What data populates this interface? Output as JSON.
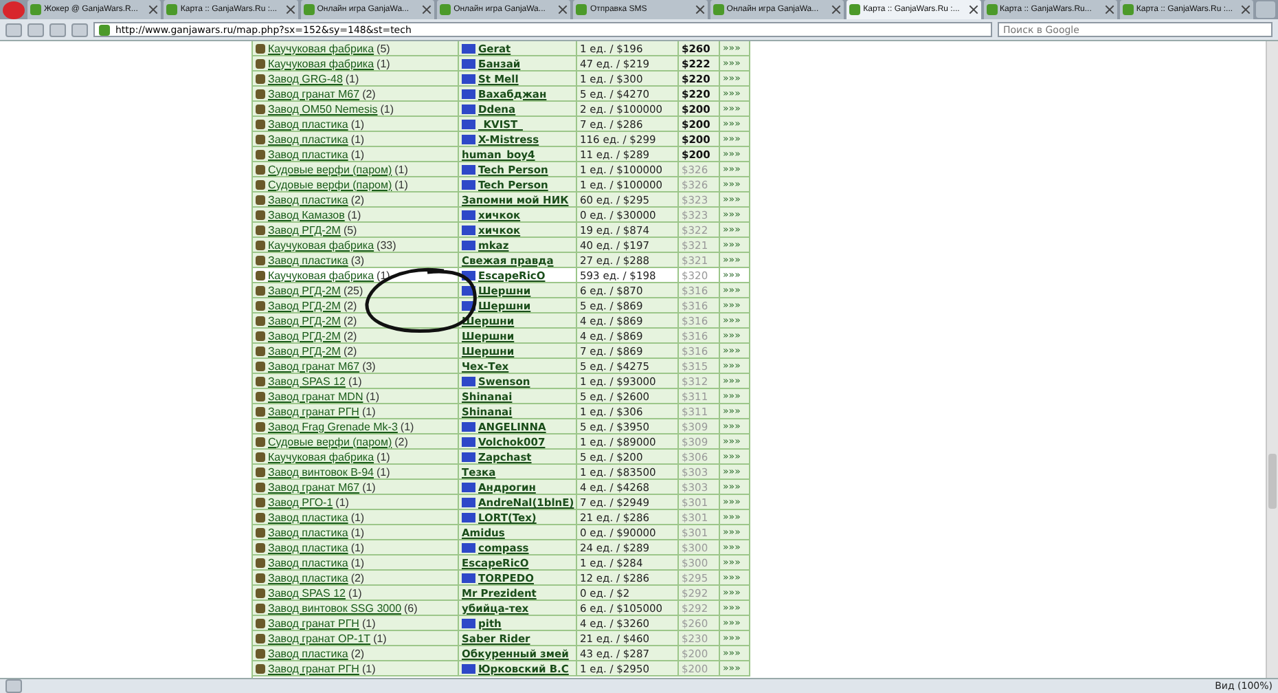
{
  "tabs": [
    {
      "label": "Жокер @ GanjaWars.R...",
      "selected": false
    },
    {
      "label": "Карта :: GanjaWars.Ru :...",
      "selected": false
    },
    {
      "label": "Онлайн игра GanjaWa...",
      "selected": false
    },
    {
      "label": "Онлайн игра GanjaWa...",
      "selected": false
    },
    {
      "label": "Отправка SMS",
      "selected": false
    },
    {
      "label": "Онлайн игра GanjaWa...",
      "selected": false
    },
    {
      "label": "Карта :: GanjaWars.Ru :...",
      "selected": true
    },
    {
      "label": "Карта :: GanjaWars.Ru...",
      "selected": false
    },
    {
      "label": "Карта :: GanjaWars.Ru :...",
      "selected": false
    }
  ],
  "address": "http://www.ganjawars.ru/map.php?sx=152&sy=148&st=tech",
  "search": {
    "placeholder": "Поиск в Google"
  },
  "rows": [
    {
      "factory": "Каучуковая фабрика",
      "count": "(5)",
      "owner": "Gerat",
      "logo": true,
      "stock": "1 ед. / $196",
      "price": "$260",
      "active": true,
      "highlighted": false,
      "more": "»»»"
    },
    {
      "factory": "Каучуковая фабрика",
      "count": "(1)",
      "owner": "Банзай",
      "logo": true,
      "stock": "47 ед. / $219",
      "price": "$222",
      "active": true,
      "highlighted": false,
      "more": "»»»"
    },
    {
      "factory": "Завод GRG-48",
      "count": "(1)",
      "owner": "St Mell",
      "logo": true,
      "stock": "1 ед. / $300",
      "price": "$220",
      "active": true,
      "highlighted": false,
      "more": "»»»"
    },
    {
      "factory": "Завод гранат М67",
      "count": "(2)",
      "owner": "Вахабджан",
      "logo": true,
      "stock": "5 ед. / $4270",
      "price": "$220",
      "active": true,
      "highlighted": false,
      "more": "»»»"
    },
    {
      "factory": "Завод OM50 Nemesis",
      "count": "(1)",
      "owner": "Ddena",
      "logo": true,
      "stock": "2 ед. / $100000",
      "price": "$200",
      "active": true,
      "highlighted": false,
      "more": "»»»"
    },
    {
      "factory": "Завод пластика",
      "count": "(1)",
      "owner": "_KVIST_",
      "logo": true,
      "stock": "7 ед. / $286",
      "price": "$200",
      "active": true,
      "highlighted": false,
      "more": "»»»"
    },
    {
      "factory": "Завод пластика",
      "count": "(1)",
      "owner": "X-Mistress",
      "logo": true,
      "stock": "116 ед. / $299",
      "price": "$200",
      "active": true,
      "highlighted": false,
      "more": "»»»"
    },
    {
      "factory": "Завод пластика",
      "count": "(1)",
      "owner": "human_boy4",
      "logo": false,
      "stock": "11 ед. / $289",
      "price": "$200",
      "active": true,
      "highlighted": false,
      "more": "»»»"
    },
    {
      "factory": "Судовые верфи (паром)",
      "count": "(1)",
      "owner": "Tech Person",
      "logo": true,
      "stock": "1 ед. / $100000",
      "price": "$326",
      "active": false,
      "highlighted": false,
      "more": "»»»"
    },
    {
      "factory": "Судовые верфи (паром)",
      "count": "(1)",
      "owner": "Tech Person",
      "logo": true,
      "stock": "1 ед. / $100000",
      "price": "$326",
      "active": false,
      "highlighted": false,
      "more": "»»»"
    },
    {
      "factory": "Завод пластика",
      "count": "(2)",
      "owner": "Запомни мой НИК",
      "logo": false,
      "stock": "60 ед. / $295",
      "price": "$323",
      "active": false,
      "highlighted": false,
      "more": "»»»"
    },
    {
      "factory": "Завод Камазов",
      "count": "(1)",
      "owner": "хичкок",
      "logo": true,
      "stock": "0 ед. / $30000",
      "price": "$323",
      "active": false,
      "highlighted": false,
      "more": "»»»"
    },
    {
      "factory": "Завод РГД-2М",
      "count": "(5)",
      "owner": "хичкок",
      "logo": true,
      "stock": "19 ед. / $874",
      "price": "$322",
      "active": false,
      "highlighted": false,
      "more": "»»»"
    },
    {
      "factory": "Каучуковая фабрика",
      "count": "(33)",
      "owner": "mkaz",
      "logo": true,
      "stock": "40 ед. / $197",
      "price": "$321",
      "active": false,
      "highlighted": false,
      "more": "»»»"
    },
    {
      "factory": "Завод пластика",
      "count": "(3)",
      "owner": "Свежая правда",
      "logo": false,
      "stock": "27 ед. / $288",
      "price": "$321",
      "active": false,
      "highlighted": false,
      "more": "»»»"
    },
    {
      "factory": "Каучуковая фабрика",
      "count": "(1)",
      "owner": "EscapeRicO",
      "logo": true,
      "stock": "593 ед. / $198",
      "price": "$320",
      "active": false,
      "highlighted": true,
      "more": "»»»"
    },
    {
      "factory": "Завод РГД-2М",
      "count": "(25)",
      "owner": "Шершни",
      "logo": true,
      "stock": "6 ед. / $870",
      "price": "$316",
      "active": false,
      "highlighted": false,
      "more": "»»»"
    },
    {
      "factory": "Завод РГД-2М",
      "count": "(2)",
      "owner": "Шершни",
      "logo": true,
      "stock": "5 ед. / $869",
      "price": "$316",
      "active": false,
      "highlighted": false,
      "more": "»»»"
    },
    {
      "factory": "Завод РГД-2М",
      "count": "(2)",
      "owner": "Шершни",
      "logo": false,
      "stock": "4 ед. / $869",
      "price": "$316",
      "active": false,
      "highlighted": false,
      "more": "»»»"
    },
    {
      "factory": "Завод РГД-2М",
      "count": "(2)",
      "owner": "Шершни",
      "logo": false,
      "stock": "4 ед. / $869",
      "price": "$316",
      "active": false,
      "highlighted": false,
      "more": "»»»"
    },
    {
      "factory": "Завод РГД-2М",
      "count": "(2)",
      "owner": "Шершни",
      "logo": false,
      "stock": "7 ед. / $869",
      "price": "$316",
      "active": false,
      "highlighted": false,
      "more": "»»»"
    },
    {
      "factory": "Завод гранат М67",
      "count": "(3)",
      "owner": "Чех-Тех",
      "logo": false,
      "stock": "5 ед. / $4275",
      "price": "$315",
      "active": false,
      "highlighted": false,
      "more": "»»»"
    },
    {
      "factory": "Завод SPAS 12",
      "count": "(1)",
      "owner": "Swenson",
      "logo": true,
      "stock": "1 ед. / $93000",
      "price": "$312",
      "active": false,
      "highlighted": false,
      "more": "»»»"
    },
    {
      "factory": "Завод гранат MDN",
      "count": "(1)",
      "owner": "Shinanai",
      "logo": false,
      "stock": "5 ед. / $2600",
      "price": "$311",
      "active": false,
      "highlighted": false,
      "more": "»»»"
    },
    {
      "factory": "Завод гранат РГН",
      "count": "(1)",
      "owner": "Shinanai",
      "logo": false,
      "stock": "1 ед. / $306",
      "price": "$311",
      "active": false,
      "highlighted": false,
      "more": "»»»"
    },
    {
      "factory": "Завод Frag Grenade Mk-3",
      "count": "(1)",
      "owner": "ANGELINNA",
      "logo": true,
      "stock": "5 ед. / $3950",
      "price": "$309",
      "active": false,
      "highlighted": false,
      "more": "»»»"
    },
    {
      "factory": "Судовые верфи (паром)",
      "count": "(2)",
      "owner": "Volchok007",
      "logo": true,
      "stock": "1 ед. / $89000",
      "price": "$309",
      "active": false,
      "highlighted": false,
      "more": "»»»"
    },
    {
      "factory": "Каучуковая фабрика",
      "count": "(1)",
      "owner": "Zapchast",
      "logo": true,
      "stock": "5 ед. / $200",
      "price": "$306",
      "active": false,
      "highlighted": false,
      "more": "»»»"
    },
    {
      "factory": "Завод винтовок В-94",
      "count": "(1)",
      "owner": "Тезка",
      "logo": false,
      "stock": "1 ед. / $83500",
      "price": "$303",
      "active": false,
      "highlighted": false,
      "more": "»»»"
    },
    {
      "factory": "Завод гранат М67",
      "count": "(1)",
      "owner": "Андрогин",
      "logo": true,
      "stock": "4 ед. / $4268",
      "price": "$303",
      "active": false,
      "highlighted": false,
      "more": "»»»"
    },
    {
      "factory": "Завод РГО-1",
      "count": "(1)",
      "owner": "AndreNal(1blnE)",
      "logo": true,
      "stock": "7 ед. / $2949",
      "price": "$301",
      "active": false,
      "highlighted": false,
      "more": "»»»"
    },
    {
      "factory": "Завод пластика",
      "count": "(1)",
      "owner": "LORT(Tex)",
      "logo": true,
      "stock": "21 ед. / $286",
      "price": "$301",
      "active": false,
      "highlighted": false,
      "more": "»»»"
    },
    {
      "factory": "Завод пластика",
      "count": "(1)",
      "owner": "Amidus",
      "logo": false,
      "stock": "0 ед. / $90000",
      "price": "$301",
      "active": false,
      "highlighted": false,
      "more": "»»»"
    },
    {
      "factory": "Завод пластика",
      "count": "(1)",
      "owner": "compass",
      "logo": true,
      "stock": "24 ед. / $289",
      "price": "$300",
      "active": false,
      "highlighted": false,
      "more": "»»»"
    },
    {
      "factory": "Завод пластика",
      "count": "(1)",
      "owner": "EscapeRicO",
      "logo": false,
      "stock": "1 ед. / $284",
      "price": "$300",
      "active": false,
      "highlighted": false,
      "more": "»»»"
    },
    {
      "factory": "Завод пластика",
      "count": "(2)",
      "owner": "TORPEDO",
      "logo": true,
      "stock": "12 ед. / $286",
      "price": "$295",
      "active": false,
      "highlighted": false,
      "more": "»»»"
    },
    {
      "factory": "Завод SPAS 12",
      "count": "(1)",
      "owner": "Mr Prezident",
      "logo": false,
      "stock": "0 ед. / $2",
      "price": "$292",
      "active": false,
      "highlighted": false,
      "more": "»»»"
    },
    {
      "factory": "Завод винтовок SSG 3000",
      "count": "(6)",
      "owner": "убийца-тех",
      "logo": false,
      "stock": "6 ед. / $105000",
      "price": "$292",
      "active": false,
      "highlighted": false,
      "more": "»»»"
    },
    {
      "factory": "Завод гранат РГН",
      "count": "(1)",
      "owner": "pith",
      "logo": true,
      "stock": "4 ед. / $3260",
      "price": "$260",
      "active": false,
      "highlighted": false,
      "more": "»»»"
    },
    {
      "factory": "Завод гранат ОР-1Т",
      "count": "(1)",
      "owner": "Saber Rider",
      "logo": false,
      "stock": "21 ед. / $460",
      "price": "$230",
      "active": false,
      "highlighted": false,
      "more": "»»»"
    },
    {
      "factory": "Завод пластика",
      "count": "(2)",
      "owner": "Обкуренный змей",
      "logo": false,
      "stock": "43 ед. / $287",
      "price": "$200",
      "active": false,
      "highlighted": false,
      "more": "»»»"
    },
    {
      "factory": "Завод гранат РГН",
      "count": "(1)",
      "owner": "Юрковский В.С",
      "logo": true,
      "stock": "1 ед. / $2950",
      "price": "$200",
      "active": false,
      "highlighted": false,
      "more": "»»»"
    }
  ],
  "status": {
    "zoom": "Вид (100%)"
  }
}
